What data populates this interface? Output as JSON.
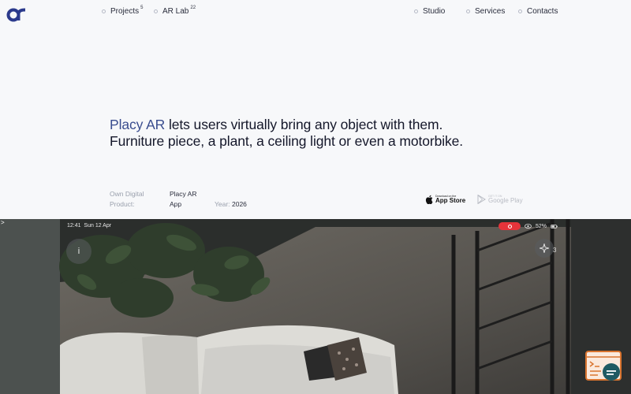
{
  "header": {
    "logo_icon": "ar-logo-icon",
    "brand_color": "#2b3a8c",
    "nav_left": [
      {
        "label": "Projects",
        "count": "5"
      },
      {
        "label": "AR Lab",
        "count": "22"
      }
    ],
    "nav_right": [
      {
        "label": "Studio"
      },
      {
        "label": "Services"
      },
      {
        "label": "Contacts"
      }
    ]
  },
  "hero": {
    "brand": "Placy AR",
    "line1_rest": " lets users virtually bring any object with them.",
    "line2": "Furniture piece, a plant, a ceiling light or even a motorbike."
  },
  "meta": {
    "type_label_1": "Own Digital",
    "type_label_2": "Product:",
    "product_1": "Placy AR",
    "product_2": "App",
    "year_label": "Year:",
    "year_value": "2026"
  },
  "stores": {
    "apple_small": "Download on the",
    "apple_big": "App Store",
    "google_small": "GET IT ON",
    "google_big": "Google Play"
  },
  "device": {
    "time": "12:41",
    "date": "Sun 12 Apr",
    "battery": "52%",
    "info_label": "i",
    "sparkle_count": "3",
    "record_color": "#e5343a"
  },
  "misc": {
    "caret": ">"
  }
}
